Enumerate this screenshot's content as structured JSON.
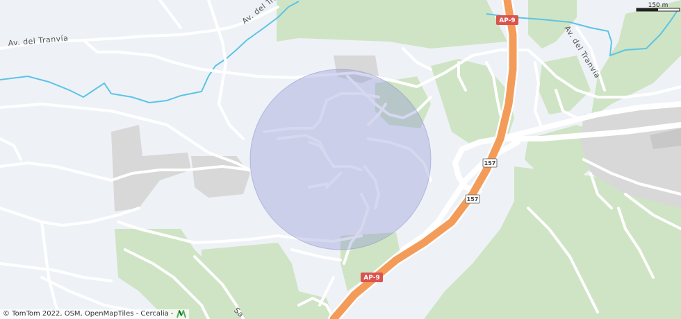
{
  "map": {
    "streets": {
      "av_tranvia_west": "Av. del Tranvía",
      "av_tranvia_north": "Av. del Tranvía",
      "av_tranvia_east": "Av. del Tranvía",
      "south_partial": "Sa"
    },
    "shields": {
      "ap9_north": "AP-9",
      "ap9_south": "AP-9",
      "n157_a": "157",
      "n157_b": "157"
    },
    "scale_label": "150 m",
    "attribution": "© TomTom 2022, OSM, OpenMapTiles - Cercalia -",
    "colors": {
      "background": "#eef2f7",
      "green_area": "#cfe4c4",
      "urban_area": "#d8d8d8",
      "water": "#5cc3e6",
      "motorway": "#f39c5a",
      "shield_red": "#d9534f",
      "circle_fill": "#8a8fd0"
    }
  }
}
